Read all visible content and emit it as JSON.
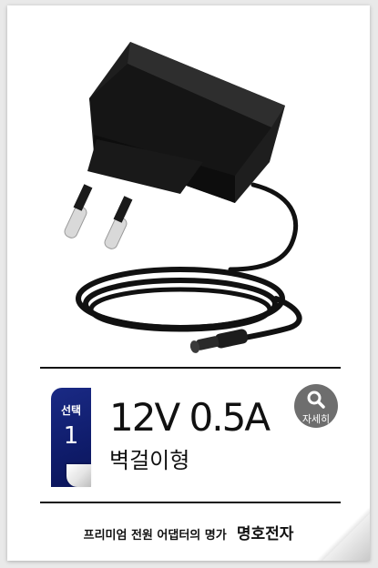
{
  "product": {
    "image_icon": "power-adapter-image",
    "selection_label": "선택",
    "selection_number": "1",
    "title": "12V 0.5A",
    "subtitle": "벽걸이형",
    "detail_label": "자세히",
    "detail_icon": "magnifier-icon"
  },
  "footer": {
    "tagline": "프리미엄 전원 어댑터의 명가",
    "brand": "명호전자"
  },
  "colors": {
    "badge": "#132275",
    "detail_button": "#6e6e6e",
    "rule": "#111111"
  }
}
